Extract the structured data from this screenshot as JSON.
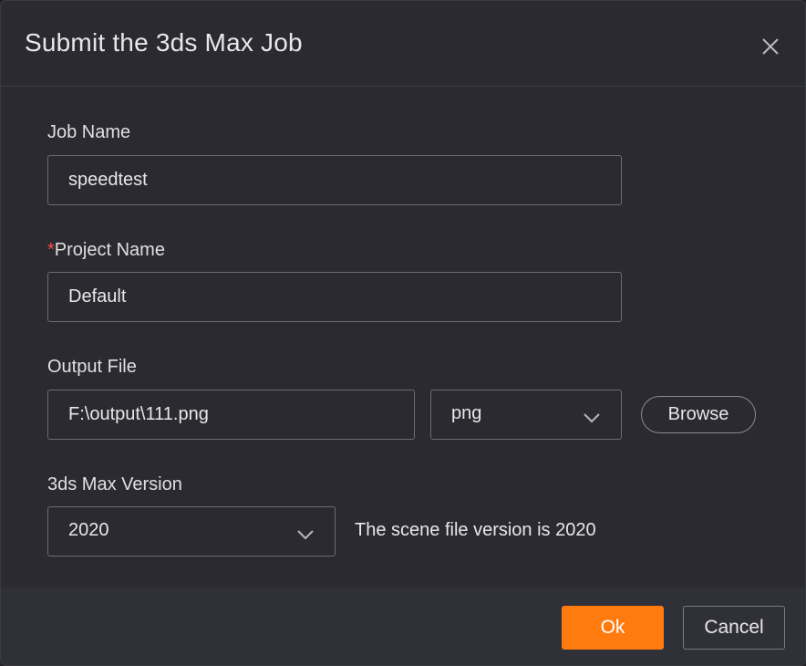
{
  "dialog": {
    "title": "Submit the 3ds Max Job",
    "close_icon": "close-icon"
  },
  "job_name": {
    "label": "Job Name",
    "value": "speedtest"
  },
  "project_name": {
    "required_mark": "*",
    "label": "Project Name",
    "value": "Default"
  },
  "output_file": {
    "label": "Output File",
    "path": "F:\\output\\111.png",
    "format": "png",
    "browse_label": "Browse"
  },
  "max_version": {
    "label": "3ds Max Version",
    "value": "2020",
    "note": "The scene file version is 2020"
  },
  "footer": {
    "ok_label": "Ok",
    "cancel_label": "Cancel"
  },
  "colors": {
    "accent": "#ff7a0f",
    "required": "#ff4d4f",
    "background": "#2a2a30"
  }
}
